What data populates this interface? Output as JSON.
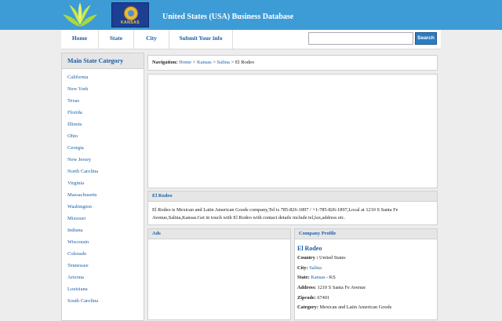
{
  "header": {
    "site_title": "United States (USA) Business Database",
    "flag_text": "KANSAS"
  },
  "nav": {
    "items": [
      {
        "label": "Home"
      },
      {
        "label": "State"
      },
      {
        "label": "City"
      },
      {
        "label": "Submit Your info"
      }
    ],
    "search_placeholder": "",
    "search_button": "Search"
  },
  "sidebar": {
    "title": "Main State Category",
    "items": [
      "California",
      "New York",
      "Texas",
      "Florida",
      "Illinois",
      "Ohio",
      "Georgia",
      "New Jersey",
      "North Carolina",
      "Virginia",
      "Massachusetts",
      "Washington",
      "Missouri",
      "Indiana",
      "Wisconsin",
      "Colorado",
      "Tennessee",
      "Arizona",
      "Louisiana",
      "South Carolina"
    ]
  },
  "breadcrumb": {
    "label": "Navigation:",
    "home": "Home",
    "sep": ">",
    "state": "Kansas",
    "city": "Salina",
    "current": "El Rodeo"
  },
  "description": {
    "title": "El Rodeo",
    "text": "El Rodeo is Mexican and Latin American Goods company,Tel is 785-826-1897 / +1-785-826-1897,Local at 1210 S Santa Fe Avenue,Salina,Kansas.Get in touch with El Rodeo with contact details include tel,fax,address etc."
  },
  "ads": {
    "title": "Ads"
  },
  "profile": {
    "title": "Company Profile",
    "name": "El Rodeo",
    "country_label": "Country :",
    "country": "United States",
    "city_label": "City:",
    "city": "Salina",
    "state_label": "State:",
    "state": "Kansas",
    "state_suffix": "- KS",
    "address_label": "Address:",
    "address": "1210 S Santa Fe Avenue",
    "zipcode_label": "Zipcode:",
    "zipcode": "67401",
    "category_label": "Category:",
    "category": "Mexican and Latin American Goods"
  },
  "colors": {
    "header_bg": "#3d9bd6",
    "link": "#1a5ea8",
    "search_button": "#2e7bbf"
  }
}
